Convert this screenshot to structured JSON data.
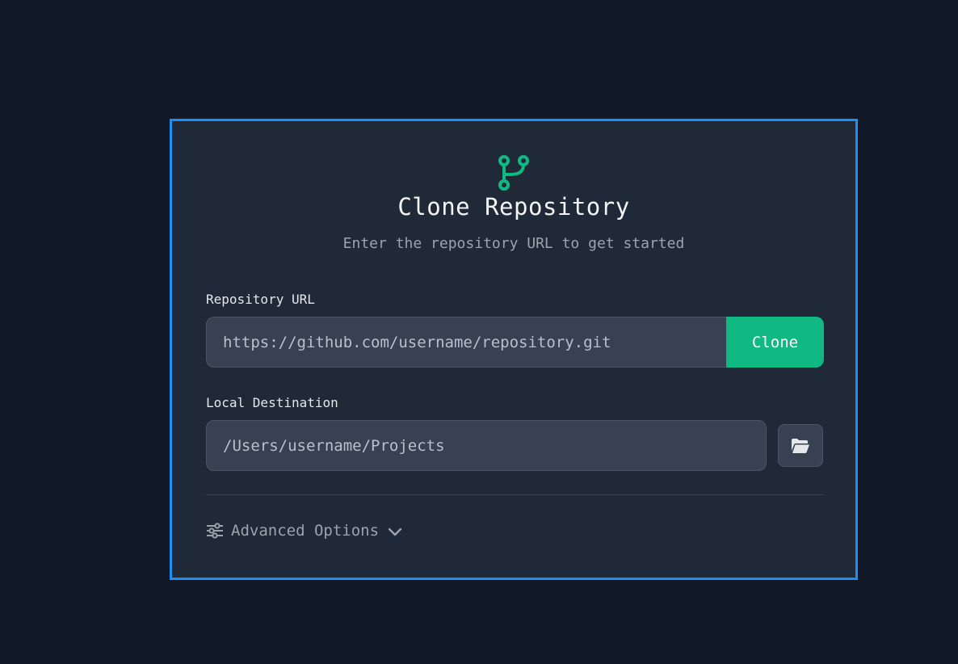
{
  "dialog": {
    "title": "Clone Repository",
    "subtitle": "Enter the repository URL to get started",
    "icon": "git-branch-icon",
    "accent_color": "#10b981",
    "border_color": "#1d8ff0"
  },
  "repository_url": {
    "label": "Repository URL",
    "placeholder": "https://github.com/username/repository.git",
    "value": ""
  },
  "clone_button": {
    "label": "Clone"
  },
  "local_destination": {
    "label": "Local Destination",
    "placeholder": "/Users/username/Projects",
    "value": "",
    "browse_icon": "folder-open-icon"
  },
  "advanced_options": {
    "label": "Advanced Options",
    "icon": "sliders-icon",
    "toggle_icon": "chevron-down-icon",
    "expanded": false
  }
}
